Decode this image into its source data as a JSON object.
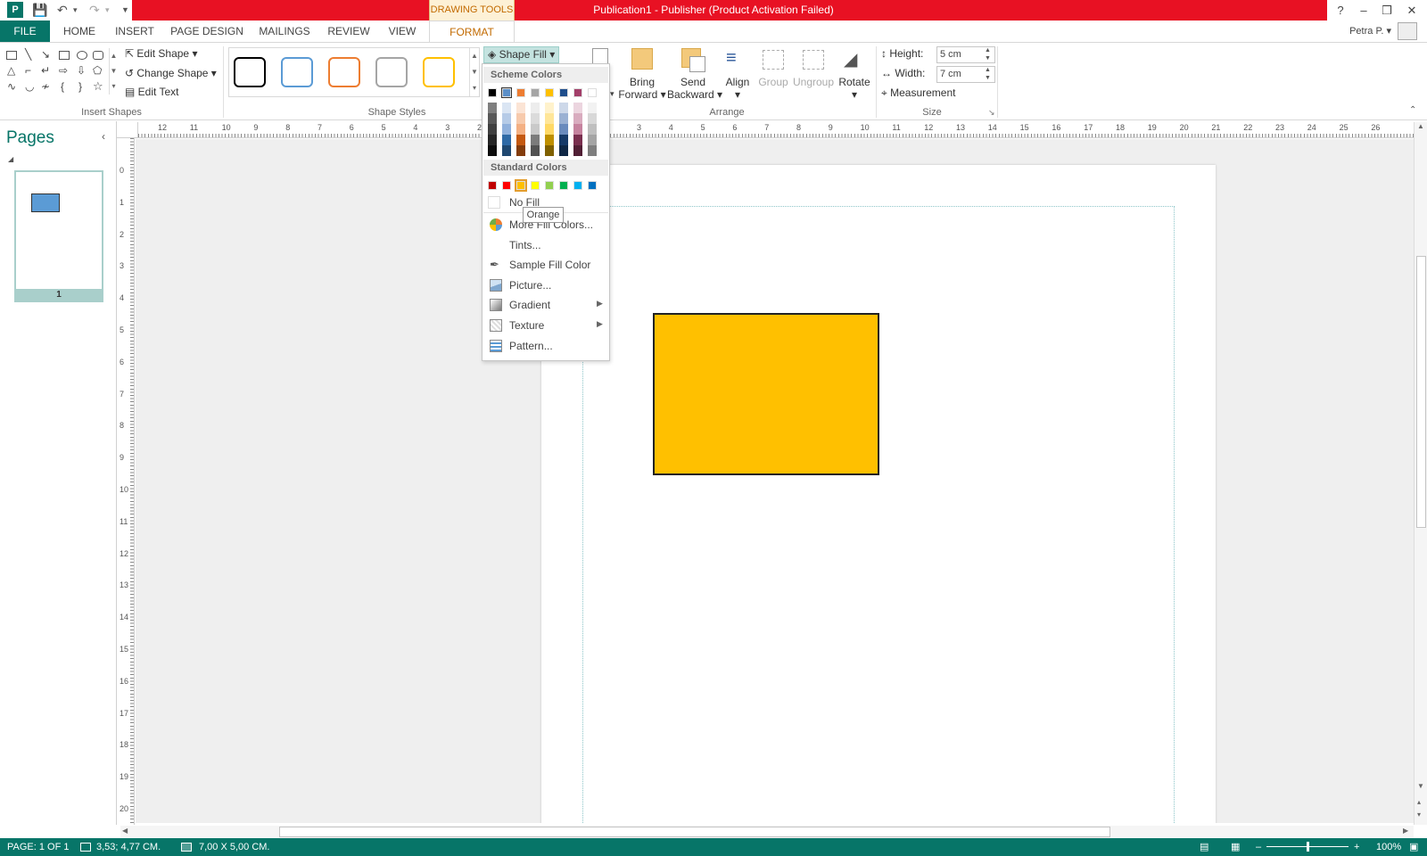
{
  "window": {
    "title": "Publication1 -  Publisher (Product Activation Failed)",
    "context_tab": "DRAWING TOOLS",
    "help": "?",
    "minimize": "–",
    "restore": "❒",
    "close": "✕"
  },
  "tabs": [
    "FILE",
    "HOME",
    "INSERT",
    "PAGE DESIGN",
    "MAILINGS",
    "REVIEW",
    "VIEW",
    "FORMAT"
  ],
  "user": "Petra P.",
  "ribbon": {
    "insert_shapes": {
      "label": "Insert Shapes",
      "edit_shape": "Edit Shape",
      "change_shape": "Change Shape",
      "edit_text": "Edit Text"
    },
    "shape_styles": {
      "label": "Shape Styles"
    },
    "shape_fill": "Shape Fill",
    "arrange": {
      "label": "Arrange",
      "bring_forward": [
        "Bring",
        "Forward"
      ],
      "send_backward": [
        "Send",
        "Backward"
      ],
      "align": "Align",
      "group": "Group",
      "ungroup": "Ungroup",
      "rotate": "Rotate"
    },
    "size": {
      "label": "Size",
      "height_label": "Height:",
      "height_value": "5 cm",
      "width_label": "Width:",
      "width_value": "7 cm",
      "measurement": "Measurement"
    }
  },
  "pages_pane": {
    "title": "Pages",
    "page_number": "1"
  },
  "fill_menu": {
    "scheme_colors_label": "Scheme Colors",
    "standard_colors_label": "Standard Colors",
    "scheme_top_row": [
      "#000000",
      "#5b8fc8",
      "#ed7d31",
      "#a5a5a5",
      "#ffc000",
      "#1f4e8c",
      "#a33f6a",
      "#ffffff"
    ],
    "scheme_tints": [
      [
        "#7f7f7f",
        "#595959",
        "#404040",
        "#262626",
        "#0d0d0d"
      ],
      [
        "#dae5f3",
        "#b6cbe7",
        "#91b1dc",
        "#2f6aa6",
        "#1f4770"
      ],
      [
        "#fbe4d5",
        "#f7caac",
        "#f4b083",
        "#c45911",
        "#833c0b"
      ],
      [
        "#ededed",
        "#dbdbdb",
        "#c9c9c9",
        "#7b7b7b",
        "#525252"
      ],
      [
        "#fff2cc",
        "#ffe699",
        "#ffd966",
        "#bf9000",
        "#7f6000"
      ],
      [
        "#cdd8e9",
        "#9bb1d3",
        "#6a8bbd",
        "#163a68",
        "#0f2745"
      ],
      [
        "#ecd5df",
        "#d9acbf",
        "#c6839f",
        "#7a2f4f",
        "#511f35"
      ],
      [
        "#f2f2f2",
        "#d8d8d8",
        "#bfbfbf",
        "#a5a5a5",
        "#7f7f7f"
      ]
    ],
    "standard_colors": [
      "#c00000",
      "#ff0000",
      "#ffc000",
      "#ffff00",
      "#92d050",
      "#00b050",
      "#00b0f0",
      "#0070c0"
    ],
    "no_fill": "No Fill",
    "items": [
      "More Fill Colors...",
      "Tints...",
      "Sample Fill Color",
      "Picture...",
      "Gradient",
      "Texture",
      "Pattern..."
    ],
    "tooltip": "Orange"
  },
  "document": {
    "shape_fill_color": "#ffc000"
  },
  "hruler_numbers": [
    "12",
    "11",
    "10",
    "9",
    "8",
    "7",
    "6",
    "5",
    "4",
    "3",
    "2",
    "1",
    "",
    "1",
    "2",
    "3",
    "4",
    "5",
    "6",
    "7",
    "8",
    "9",
    "10",
    "11",
    "12",
    "13",
    "14",
    "15",
    "16",
    "17",
    "18",
    "19",
    "20",
    "21",
    "22",
    "23",
    "24",
    "25",
    "26"
  ],
  "vruler_numbers": [
    "0",
    "1",
    "2",
    "3",
    "4",
    "5",
    "6",
    "7",
    "8",
    "9",
    "10",
    "11",
    "12",
    "13",
    "14",
    "15",
    "16",
    "17",
    "18",
    "19",
    "20"
  ],
  "status": {
    "page": "PAGE: 1 OF 1",
    "position": "3,53; 4,77 CM.",
    "size": "7,00 X  5,00 CM.",
    "zoom": "100%"
  }
}
